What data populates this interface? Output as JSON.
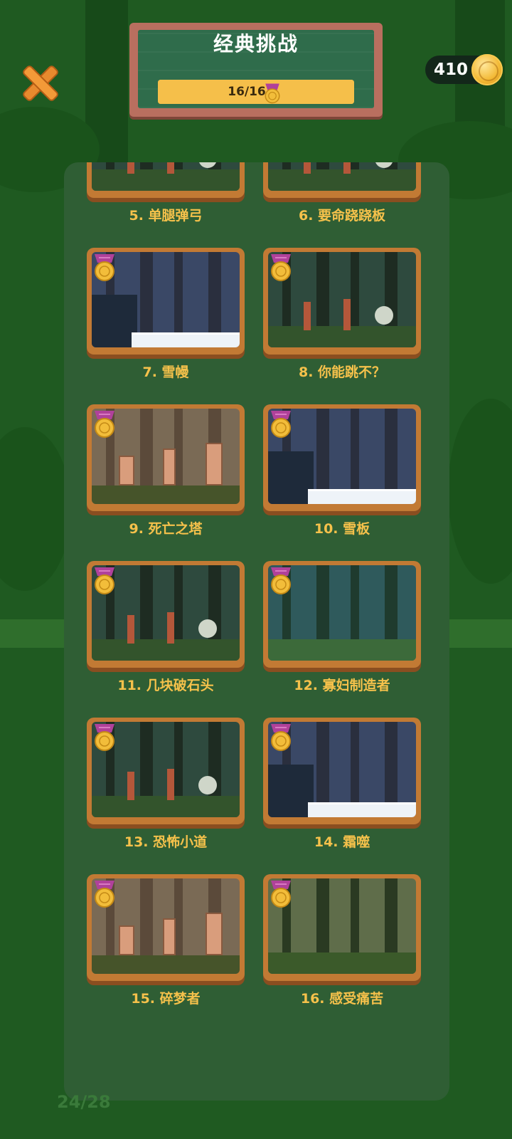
{
  "header": {
    "title": "经典挑战",
    "progress_text": "16/16",
    "progress_fraction": 1.0,
    "coins": "410"
  },
  "icons": {
    "close": "close-x-icon",
    "coin": "gold-coin-icon",
    "medal": "gold-medal-icon"
  },
  "levels": [
    {
      "label": "5. 单腿弹弓",
      "scene": "forest"
    },
    {
      "label": "6. 要命跷跷板",
      "scene": "forest"
    },
    {
      "label": "7. 雪幔",
      "scene": "snow"
    },
    {
      "label": "8. 你能跳不？",
      "scene": "forest"
    },
    {
      "label": "9. 死亡之塔",
      "scene": "desert"
    },
    {
      "label": "10. 雪板",
      "scene": "snow"
    },
    {
      "label": "11. 几块破石头",
      "scene": "forest"
    },
    {
      "label": "12. 寡妇制造者",
      "scene": "pine"
    },
    {
      "label": "13. 恐怖小道",
      "scene": "forest"
    },
    {
      "label": "14. 霜噬",
      "scene": "snow"
    },
    {
      "label": "15. 碎梦者",
      "scene": "desert"
    },
    {
      "label": "16. 感受痛苦",
      "scene": "jungle"
    }
  ],
  "footer": {
    "count": "24/28"
  },
  "colors": {
    "label": "#f5c14b",
    "frame": "#c27a34",
    "panel": "#2f5e34",
    "background": "#1f5a21"
  }
}
